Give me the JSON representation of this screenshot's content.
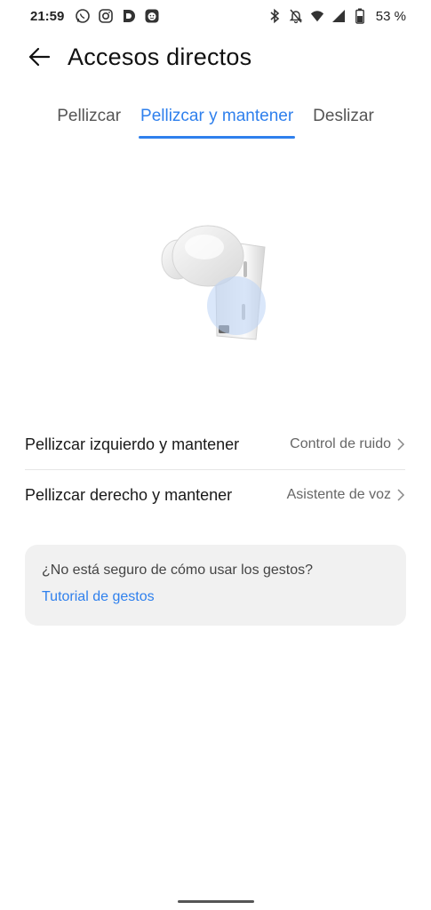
{
  "status_bar": {
    "time": "21:59",
    "battery_percent": "53 %",
    "left_icons": [
      "whatsapp-icon",
      "instagram-icon",
      "d-app-icon",
      "face-app-icon"
    ],
    "right_icons": [
      "bluetooth-icon",
      "muted-bell-icon",
      "wifi-icon",
      "signal-icon",
      "battery-icon"
    ]
  },
  "app_bar": {
    "title": "Accesos directos"
  },
  "tabs": [
    {
      "label": "Pellizcar",
      "active": false
    },
    {
      "label": "Pellizcar y mantener",
      "active": true
    },
    {
      "label": "Deslizar",
      "active": false
    }
  ],
  "settings": [
    {
      "label": "Pellizcar izquierdo y mantener",
      "value": "Control de ruido"
    },
    {
      "label": "Pellizcar derecho y mantener",
      "value": "Asistente de voz"
    }
  ],
  "help": {
    "question": "¿No está seguro de cómo usar los gestos?",
    "link": "Tutorial de gestos"
  },
  "colors": {
    "accent": "#2f80ed",
    "card_background": "#f1f1f1"
  }
}
